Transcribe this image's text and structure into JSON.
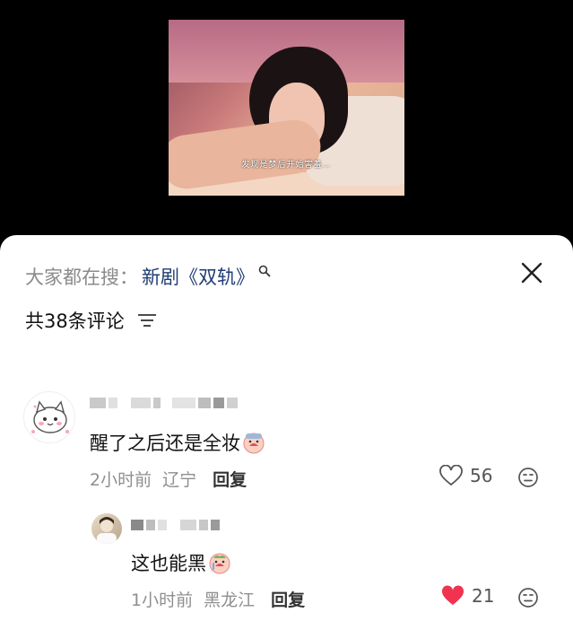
{
  "video": {
    "subtitle": "发现是梦后开始害羞…"
  },
  "search": {
    "prefix": "大家都在搜：",
    "term": "新剧《双轨》"
  },
  "comments_header": {
    "count_label": "共38条评论"
  },
  "comments": [
    {
      "text": "醒了之后还是全妆",
      "time": "2小时前",
      "location": "辽宁",
      "reply_label": "回复",
      "likes": "56",
      "liked": false
    },
    {
      "text": "这也能黑",
      "time": "1小时前",
      "location": "黑龙江",
      "reply_label": "回复",
      "likes": "21",
      "liked": true
    }
  ],
  "colors": {
    "link": "#1f3c74",
    "like_active": "#f0344f"
  }
}
